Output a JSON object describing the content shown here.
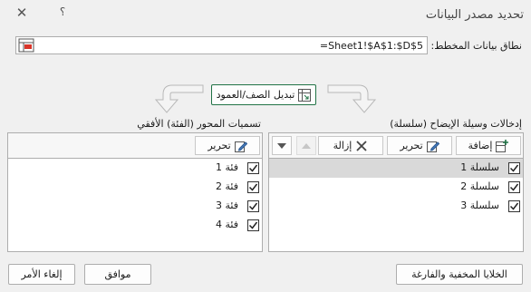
{
  "dialog": {
    "title": "تحديد مصدر البيانات",
    "help_symbol": "؟",
    "close_symbol": "✕"
  },
  "range": {
    "label": "نطاق بيانات المخطط:",
    "value": "=Sheet1!$A$1:$D$5"
  },
  "switch_button": {
    "label": "تبديل الصف/العمود"
  },
  "legend": {
    "title": "إدخالات وسيلة الإيضاح (سلسلة)",
    "add_label": "إضافة",
    "edit_label": "تحرير",
    "remove_label": "إزالة",
    "items": [
      {
        "label": "سلسلة 1",
        "checked": true,
        "selected": true
      },
      {
        "label": "سلسلة 2",
        "checked": true,
        "selected": false
      },
      {
        "label": "سلسلة 3",
        "checked": true,
        "selected": false
      }
    ]
  },
  "axis": {
    "title": "تسميات المحور (الفئة) الأفقي",
    "edit_label": "تحرير",
    "items": [
      {
        "label": "فئة 1",
        "checked": true
      },
      {
        "label": "فئة 2",
        "checked": true
      },
      {
        "label": "فئة 3",
        "checked": true
      },
      {
        "label": "فئة 4",
        "checked": true
      }
    ]
  },
  "footer": {
    "hidden_cells_label": "الخلايا المخفية والفارغة",
    "ok_label": "موافق",
    "cancel_label": "إلغاء الأمر"
  },
  "colors": {
    "selected_row": "#d9d9d9",
    "accent": "#217346",
    "arrow": "#b8b8b8"
  }
}
